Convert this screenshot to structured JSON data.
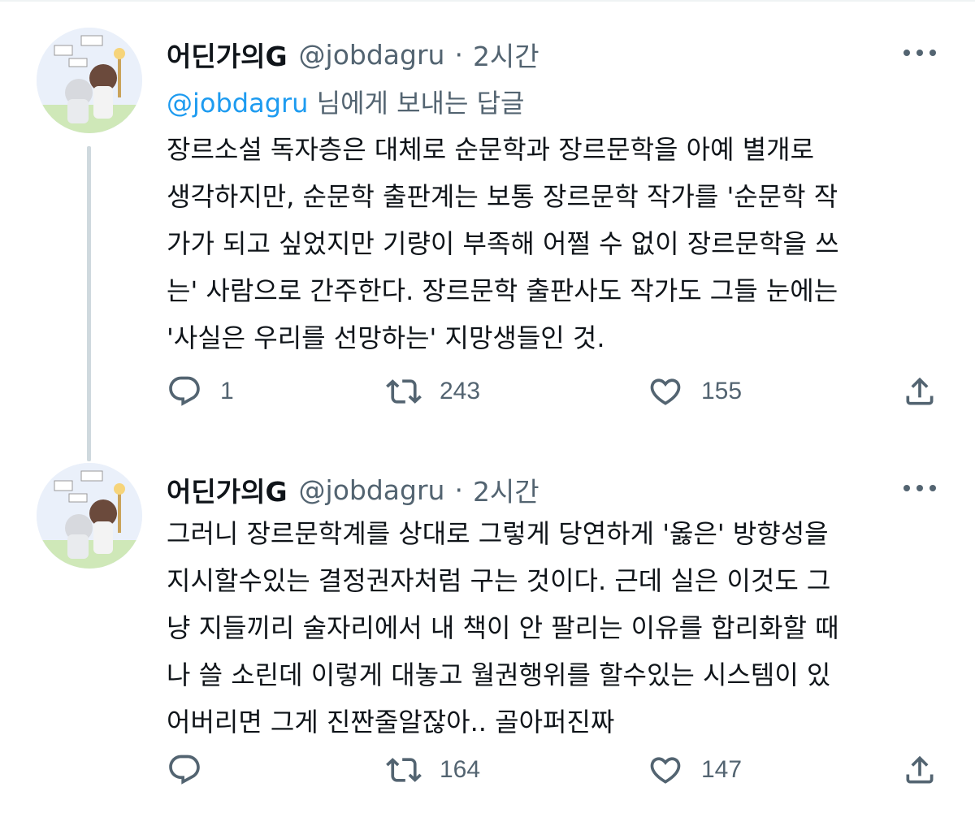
{
  "colors": {
    "accent": "#1d9bf0",
    "secondary_text": "#536471",
    "primary_text": "#0f1419",
    "thread_line": "#cfd9de"
  },
  "tweets": [
    {
      "display_name": "어딘가의G",
      "handle": "@jobdagru",
      "separator": "·",
      "time": "2시간",
      "reply_to": {
        "mention": "@jobdagru",
        "suffix": " 님에게 보내는 답글"
      },
      "lines": [
        "장르소설 독자층은 대체로 순문학과 장르문학을 아예 별개로",
        "생각하지만, 순문학 출판계는 보통 장르문학 작가를 '순문학 작",
        "가가 되고 싶었지만 기량이 부족해 어쩔 수 없이 장르문학을 쓰",
        "는' 사람으로 간주한다. 장르문학 출판사도 작가도 그들 눈에는",
        "'사실은 우리를 선망하는' 지망생들인 것."
      ],
      "replies": "1",
      "retweets": "243",
      "likes": "155",
      "icons": [
        "reply-icon",
        "retweet-icon",
        "like-icon",
        "share-icon",
        "more-icon"
      ]
    },
    {
      "display_name": "어딘가의G",
      "handle": "@jobdagru",
      "separator": "·",
      "time": "2시간",
      "lines": [
        "그러니 장르문학계를 상대로 그렇게 당연하게 '옳은' 방향성을",
        "지시할수있는 결정권자처럼 구는 것이다. 근데 실은 이것도 그",
        "냥 지들끼리 술자리에서 내 책이 안 팔리는 이유를 합리화할 때",
        "나 쓸 소린데 이렇게 대놓고 월권행위를 할수있는 시스템이 있",
        "어버리면 그게 진짠줄알잖아.. 골아퍼진짜"
      ],
      "replies": "",
      "retweets": "164",
      "likes": "147",
      "icons": [
        "reply-icon",
        "retweet-icon",
        "like-icon",
        "share-icon",
        "more-icon"
      ]
    }
  ]
}
